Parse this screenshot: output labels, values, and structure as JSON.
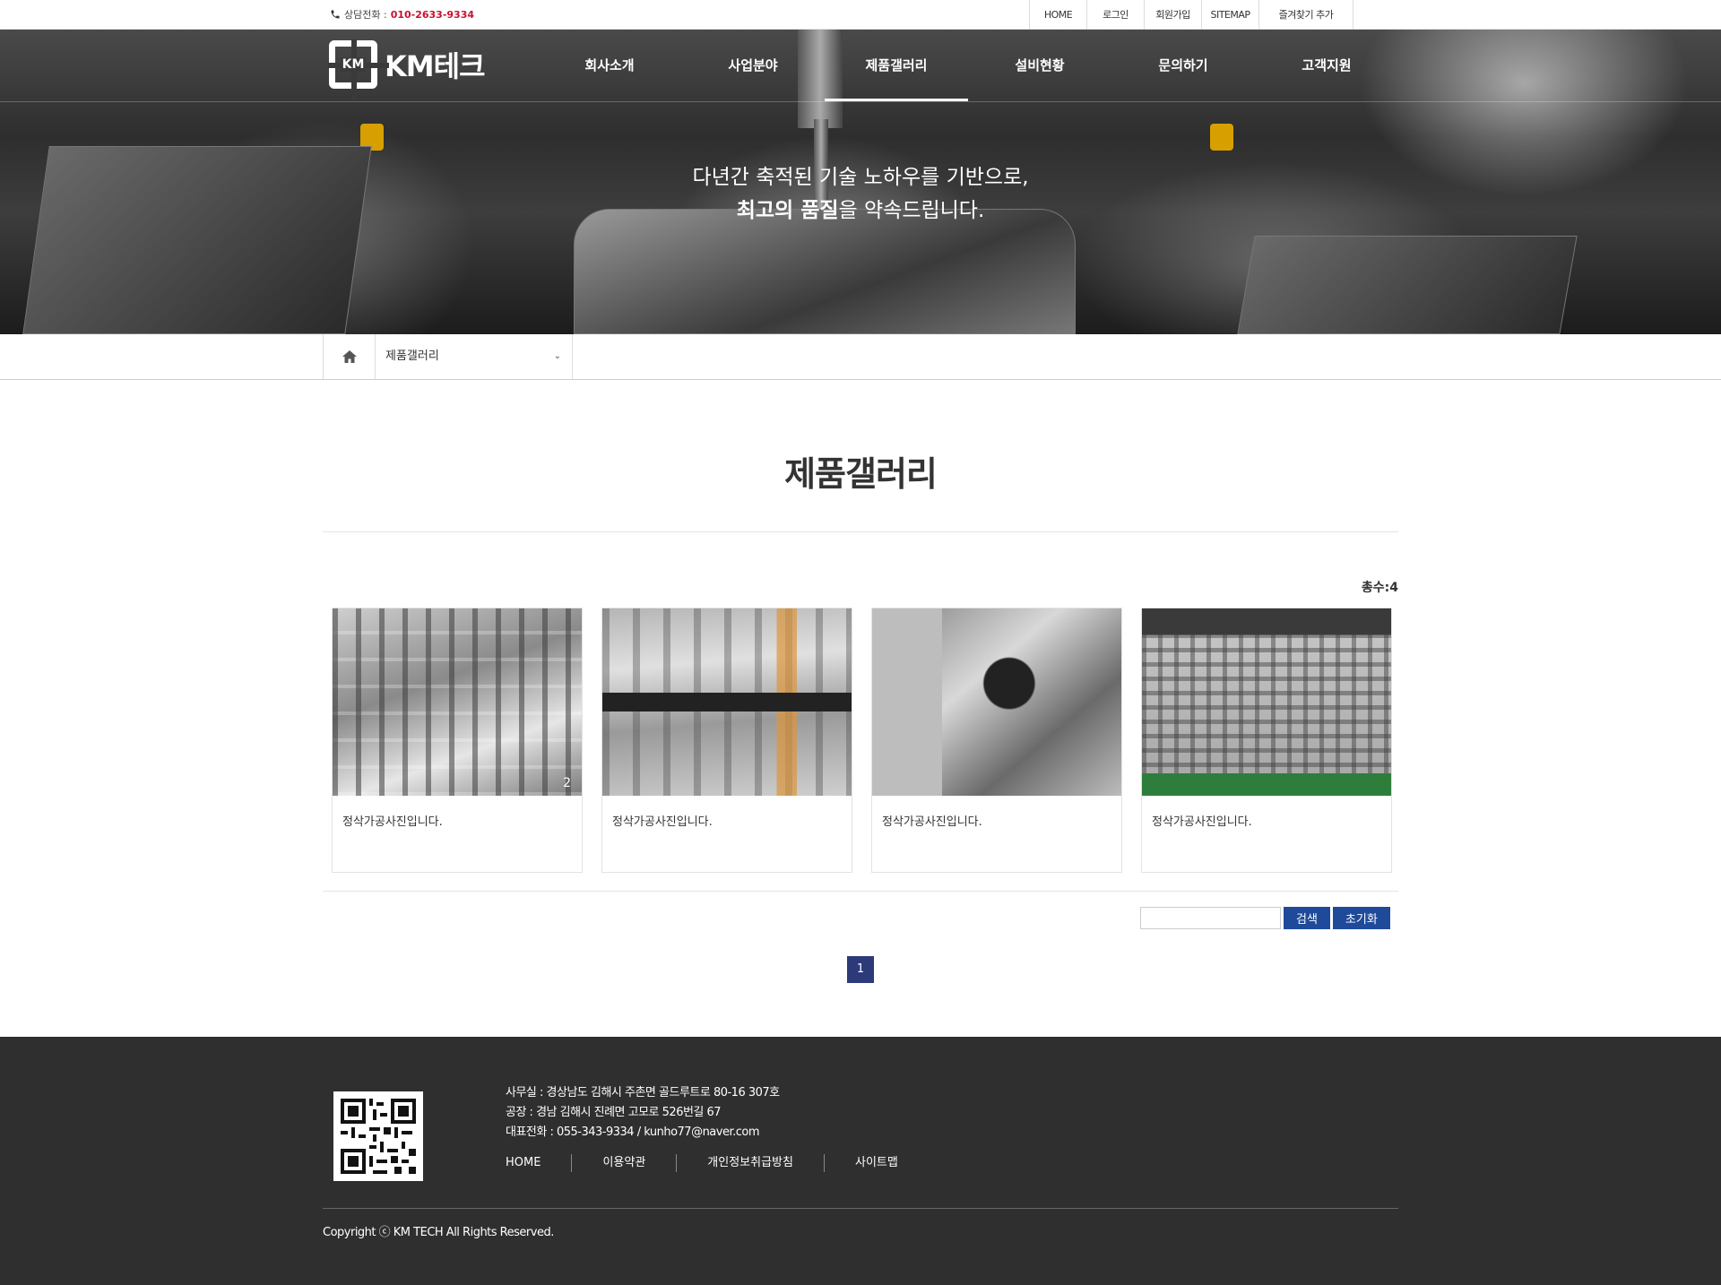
{
  "topbar": {
    "phone_label": "상담전화 :",
    "phone_number": "010-2633-9334",
    "links": [
      "HOME",
      "로그인",
      "회원가입",
      "SITEMAP",
      "즐겨찾기 추가"
    ]
  },
  "logo": {
    "mark": "KM",
    "text": "KM테크"
  },
  "nav": {
    "items": [
      "회사소개",
      "사업분야",
      "제품갤러리",
      "설비현황",
      "문의하기",
      "고객지원"
    ],
    "active": "제품갤러리"
  },
  "hero": {
    "line1": "다년간 축적된 기술 노하우를 기반으로,",
    "line2_bold": "최고의 품질",
    "line2_rest": "을 약속드립니다."
  },
  "location": {
    "current": "제품갤러리"
  },
  "page": {
    "title": "제품갤러리",
    "total_label": "총수:4"
  },
  "gallery": {
    "items": [
      {
        "caption": "정삭가공사진입니다.",
        "badge": "2"
      },
      {
        "caption": "정삭가공사진입니다.",
        "badge": ""
      },
      {
        "caption": "정삭가공사진입니다.",
        "badge": ""
      },
      {
        "caption": "정삭가공사진입니다.",
        "badge": ""
      }
    ]
  },
  "search": {
    "button": "검색",
    "reset": "초기화",
    "value": ""
  },
  "pagination": {
    "current": "1"
  },
  "footer": {
    "office": "사무실 : 경상남도 김해시 주촌면 골드루트로 80-16 307호",
    "factory": "공장 : 경남 김해시 진례면 고모로 526번길 67",
    "contact": "대표전화 : 055-343-9334 / kunho77@naver.com",
    "links": [
      "HOME",
      "이용약관",
      "개인정보취급방침",
      "사이트맵"
    ],
    "copyright": "Copyright ⓒ KM TECH All Rights Reserved."
  },
  "colors": {
    "accent": "#1f4a9a",
    "phone": "#c8102e",
    "footer_bg": "#2f2f2f",
    "pager": "#2c3a7a"
  }
}
